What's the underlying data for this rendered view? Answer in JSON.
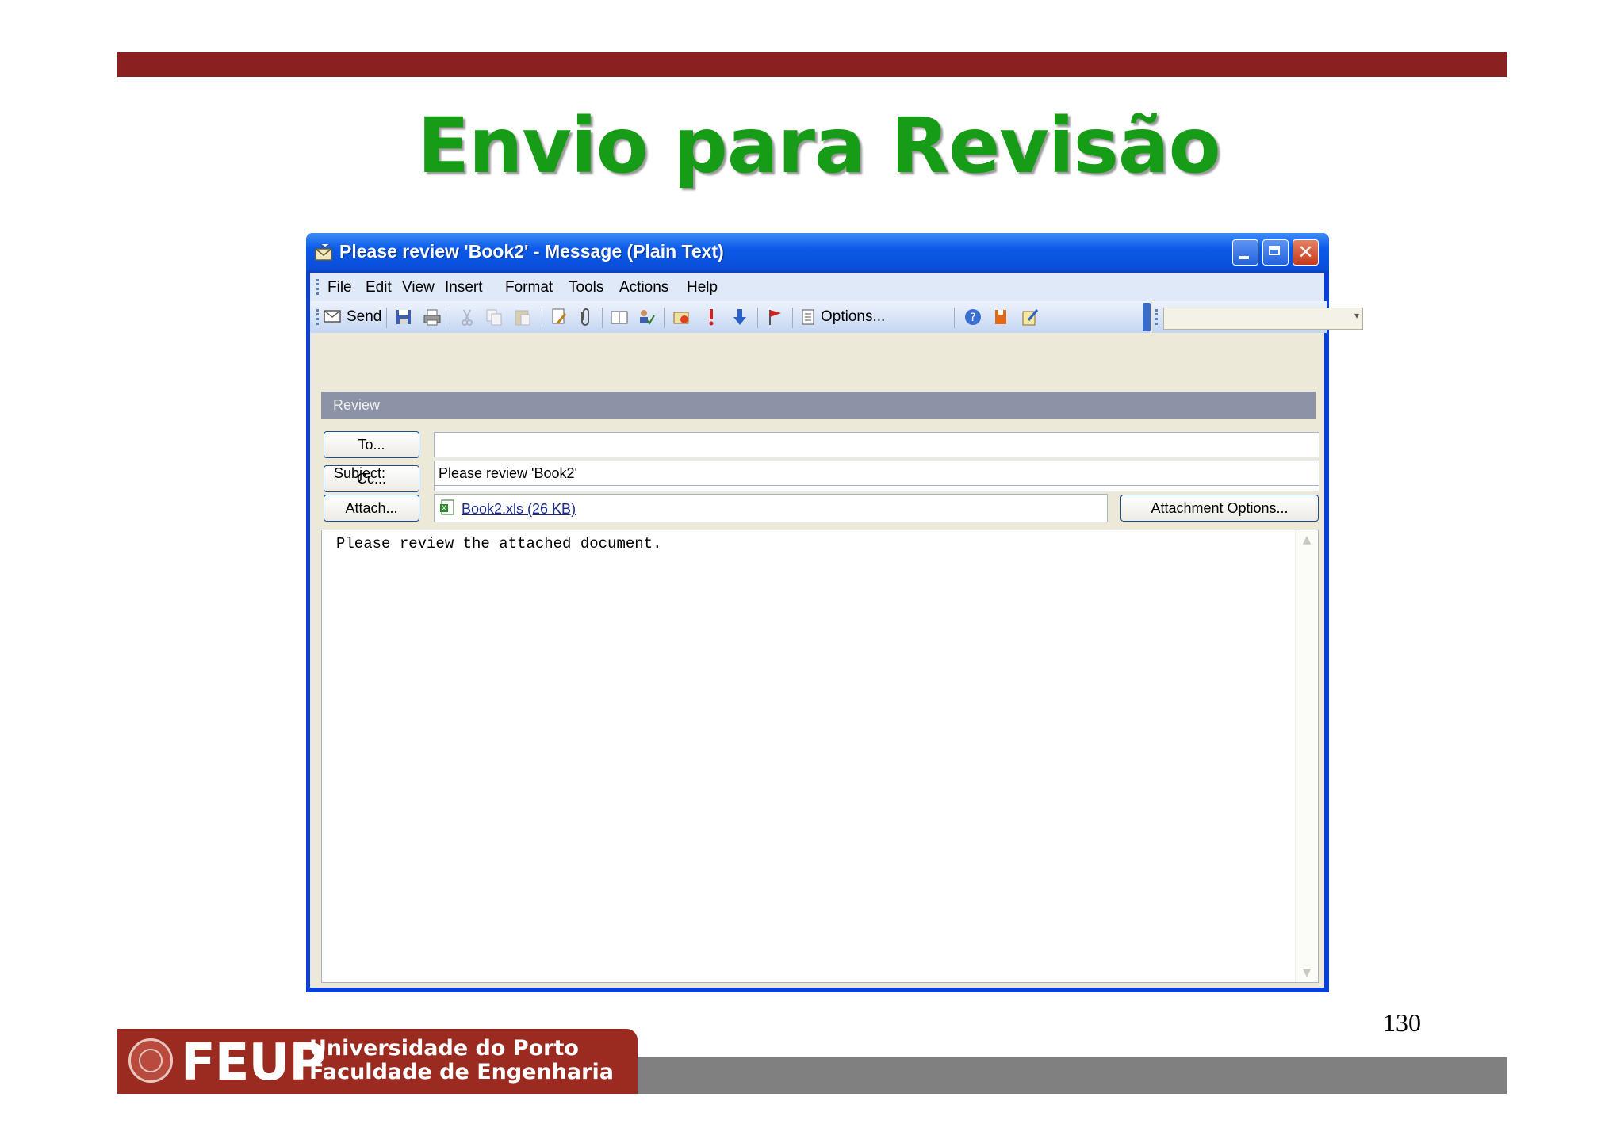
{
  "slide": {
    "title": "Envio para Revisão",
    "page_number": "130",
    "footer": {
      "logo": "FEUP",
      "university_line1": "Universidade do Porto",
      "university_line2": "Faculdade de Engenharia"
    }
  },
  "window": {
    "title": "Please review 'Book2' - Message (Plain Text)",
    "menu": [
      "File",
      "Edit",
      "View",
      "Insert",
      "Format",
      "Tools",
      "Actions",
      "Help"
    ],
    "toolbar": {
      "send_label": "Send",
      "options_label": "Options...",
      "icons": [
        "send-icon",
        "save-icon",
        "print-icon",
        "cut-icon",
        "copy-icon",
        "paste-icon",
        "insert-file-icon",
        "attach-icon",
        "address-book-icon",
        "check-names-icon",
        "flag-mail-icon",
        "importance-high-icon",
        "importance-low-icon",
        "follow-up-flag-icon",
        "options-icon",
        "help-icon",
        "office-icon",
        "edit-icon"
      ]
    },
    "review_bar": "Review",
    "fields": {
      "to_button": "To...",
      "to_value": "",
      "cc_button": "Cc...",
      "cc_value": "",
      "subject_label": "Subject:",
      "subject_value": "Please review 'Book2'",
      "attach_button": "Attach...",
      "attachment": "Book2.xls (26 KB)",
      "attachment_options_button": "Attachment Options..."
    },
    "body": "Please review the attached document.",
    "colors": {
      "titlebar": "#0a52e0",
      "close_button": "#d0482a",
      "review_bar": "#8c93a6"
    }
  }
}
